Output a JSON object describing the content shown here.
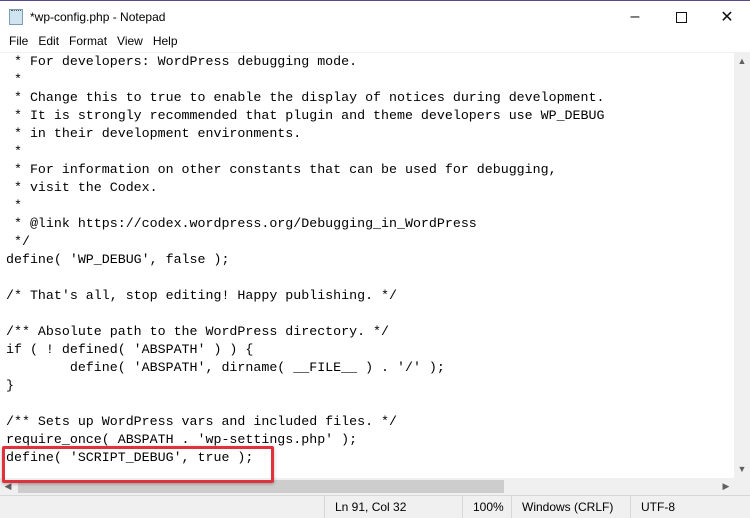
{
  "window": {
    "title": "*wp-config.php - Notepad",
    "minimize_icon": "minimize-icon",
    "maximize_icon": "maximize-icon",
    "close_icon": "close-icon"
  },
  "menu": [
    "File",
    "Edit",
    "Format",
    "View",
    "Help"
  ],
  "lines": [
    " * For developers: WordPress debugging mode.",
    " *",
    " * Change this to true to enable the display of notices during development.",
    " * It is strongly recommended that plugin and theme developers use WP_DEBUG",
    " * in their development environments.",
    " *",
    " * For information on other constants that can be used for debugging,",
    " * visit the Codex.",
    " *",
    " * @link https://codex.wordpress.org/Debugging_in_WordPress",
    " */",
    "define( 'WP_DEBUG', false );",
    "",
    "/* That's all, stop editing! Happy publishing. */",
    "",
    "/** Absolute path to the WordPress directory. */",
    "if ( ! defined( 'ABSPATH' ) ) {",
    "        define( 'ABSPATH', dirname( __FILE__ ) . '/' );",
    "}",
    "",
    "/** Sets up WordPress vars and included files. */",
    "require_once( ABSPATH . 'wp-settings.php' );",
    "define( 'SCRIPT_DEBUG', true );"
  ],
  "status": {
    "position": "Ln 91, Col 32",
    "zoom": "100%",
    "line_ending": "Windows (CRLF)",
    "encoding": "UTF-8"
  },
  "colors": {
    "highlight": "#e0323c"
  }
}
